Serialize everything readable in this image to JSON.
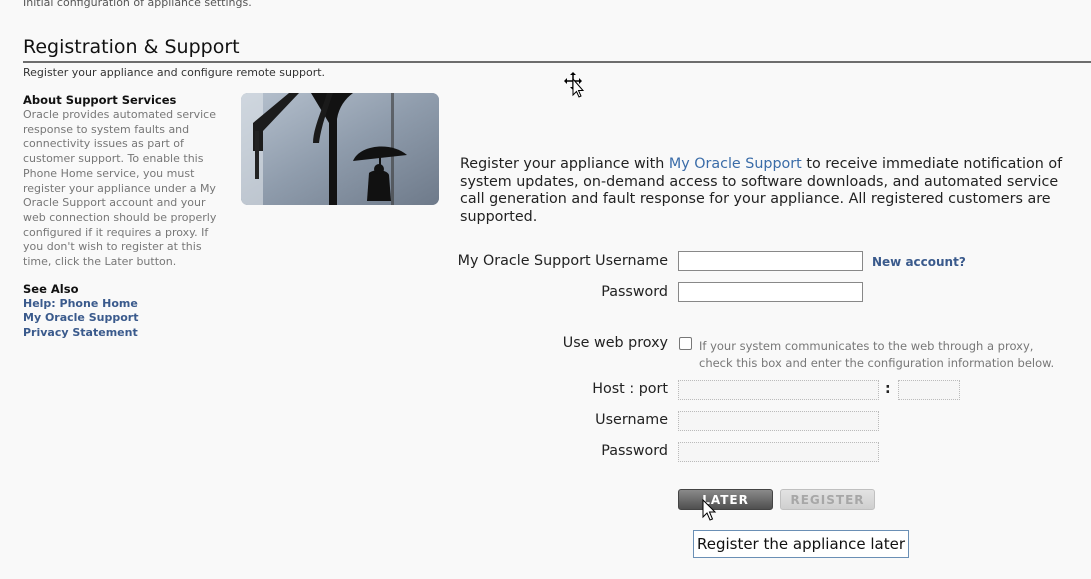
{
  "header": {
    "cut_text": "Initial configuration of appliance settings.",
    "title": "Registration & Support",
    "subtitle": "Register your appliance and configure remote support."
  },
  "sidebar": {
    "about_heading": "About Support Services",
    "about_text": "Oracle provides automated service response to system faults and connectivity issues as part of customer support. To enable this Phone Home service, you must register your appliance under a My Oracle Support account and your web connection should be properly configured if it requires a proxy. If you don't wish to register at this time, click the Later button.",
    "see_also_heading": "See Also",
    "links": [
      "Help: Phone Home",
      "My Oracle Support",
      "Privacy Statement"
    ]
  },
  "intro": {
    "before": "Register your appliance with ",
    "link": "My Oracle Support",
    "after": " to receive immediate notification of system updates, on-demand access to software downloads, and automated service call generation and fault response for your appliance. All registered customers are supported."
  },
  "form": {
    "mos_username_label": "My Oracle Support Username",
    "mos_username_value": "",
    "mos_password_label": "Password",
    "mos_password_value": "",
    "new_account_link": "New account?",
    "proxy_label": "Use web proxy",
    "proxy_checked": false,
    "proxy_help": "If your system communicates to the web through a proxy, check this box and enter the configuration information below.",
    "host_port_label": "Host : port",
    "host_value": "",
    "port_separator": ":",
    "port_value": "",
    "proxy_username_label": "Username",
    "proxy_username_value": "",
    "proxy_password_label": "Password",
    "proxy_password_value": ""
  },
  "buttons": {
    "later": "LATER",
    "register": "REGISTER"
  },
  "tooltip": "Register the appliance later",
  "colors": {
    "link": "#3a5a8c",
    "rule": "#6d6d6d",
    "later_bg": "#5e5e5e",
    "register_bg": "#d8d8d8"
  }
}
